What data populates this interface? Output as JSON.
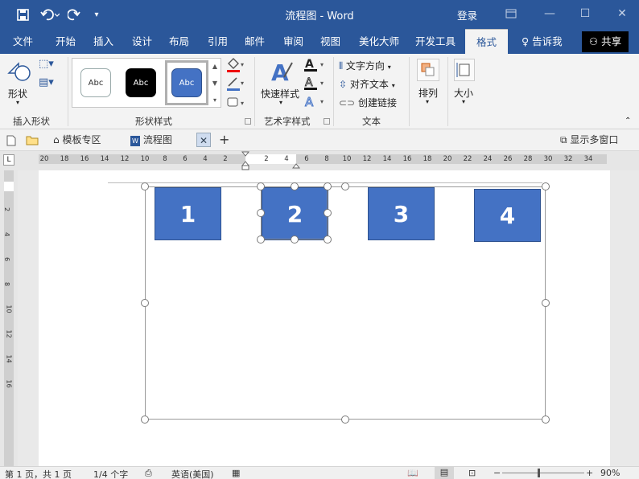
{
  "window": {
    "title": "流程图 - Word",
    "login": "登录"
  },
  "quick_access": {
    "save_icon": "save-icon",
    "undo_icon": "undo-icon",
    "redo_icon": "redo-icon",
    "customize_icon": "customize-icon"
  },
  "tabs": [
    {
      "label": "文件"
    },
    {
      "label": "开始"
    },
    {
      "label": "插入"
    },
    {
      "label": "设计"
    },
    {
      "label": "布局"
    },
    {
      "label": "引用"
    },
    {
      "label": "邮件"
    },
    {
      "label": "审阅"
    },
    {
      "label": "视图"
    },
    {
      "label": "美化大师"
    },
    {
      "label": "开发工具"
    },
    {
      "label": "格式"
    }
  ],
  "tell_me": "告诉我",
  "share": "共享",
  "ribbon": {
    "insert_shapes": {
      "shape_label": "形状",
      "group_label": "插入形状"
    },
    "shape_styles": {
      "group_label": "形状样式",
      "gallery": [
        "Abc",
        "Abc",
        "Abc"
      ]
    },
    "wordart": {
      "quick_styles": "快速样式",
      "group_label": "艺术字样式"
    },
    "text": {
      "direction": "文字方向",
      "align": "对齐文本",
      "link": "创建链接",
      "group_label": "文本"
    },
    "arrange": {
      "label": "排列"
    },
    "size": {
      "label": "大小"
    }
  },
  "tabstrip": {
    "templates": "模板专区",
    "doc": "流程图",
    "multi_window": "显示多窗口"
  },
  "ruler": {
    "h_numbers": [
      "20",
      "18",
      "16",
      "14",
      "12",
      "10",
      "8",
      "6",
      "4",
      "2",
      "2",
      "4",
      "6",
      "8",
      "10",
      "12",
      "14",
      "16",
      "18",
      "20",
      "22",
      "24",
      "26",
      "28",
      "30",
      "32",
      "34"
    ],
    "v_numbers": [
      "2",
      "4",
      "6",
      "8",
      "10",
      "12",
      "14",
      "16"
    ]
  },
  "shapes": [
    {
      "label": "1"
    },
    {
      "label": "2"
    },
    {
      "label": "3"
    },
    {
      "label": "4"
    }
  ],
  "statusbar": {
    "page": "第 1 页，共 1 页",
    "words": "1/4 个字",
    "lang": "英语(美国)",
    "zoom": "90%"
  },
  "colors": {
    "brand": "#2b579a",
    "shape_fill": "#4472c4",
    "shape_border": "#2f528f"
  }
}
